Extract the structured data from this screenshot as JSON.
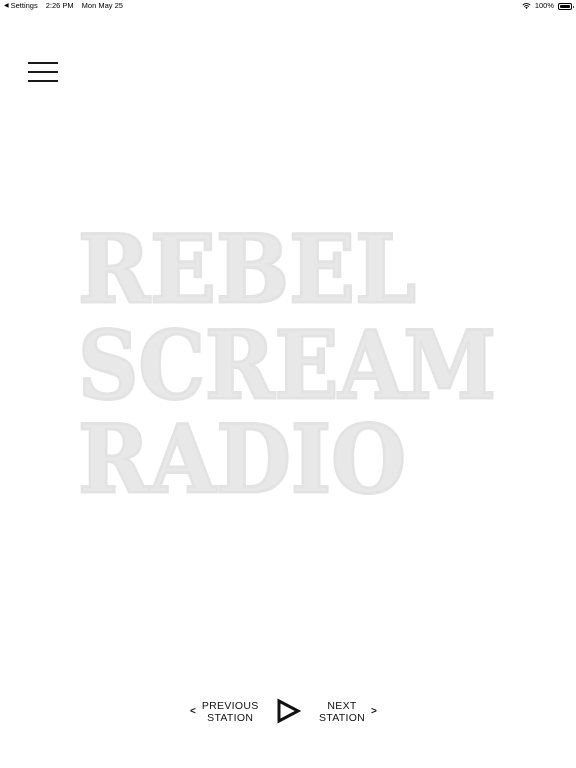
{
  "status_bar": {
    "back_app": "Settings",
    "time": "2:26 PM",
    "date": "Mon May 25",
    "battery": "100%"
  },
  "menu": {
    "icon": "hamburger-menu-icon"
  },
  "logo": {
    "line1": "REBEL",
    "line2": "SCREAM",
    "line3": "RADIO"
  },
  "controls": {
    "prev_line1": "PREVIOUS",
    "prev_line2": "STATION",
    "prev_chevron": "<",
    "next_line1": "NEXT",
    "next_line2": "STATION",
    "next_chevron": ">",
    "play_icon": "play-icon"
  },
  "colors": {
    "background": "#ffffff",
    "logo": "#e8e8e8",
    "text": "#111111"
  }
}
